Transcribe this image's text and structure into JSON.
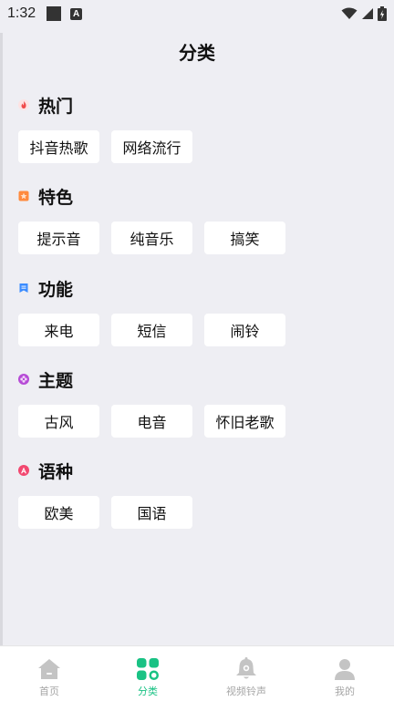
{
  "status_bar": {
    "time": "1:32",
    "badge_letter": "A"
  },
  "page": {
    "title": "分类"
  },
  "sections": [
    {
      "title": "热门",
      "icon": "fire-icon",
      "color": "#f04b4b",
      "chips": [
        "抖音热歌",
        "网络流行"
      ]
    },
    {
      "title": "特色",
      "icon": "star-square-icon",
      "color": "#ff8a3d",
      "chips": [
        "提示音",
        "纯音乐",
        "搞笑"
      ]
    },
    {
      "title": "功能",
      "icon": "bookmark-icon",
      "color": "#3b8cff",
      "chips": [
        "来电",
        "短信",
        "闹铃"
      ]
    },
    {
      "title": "主题",
      "icon": "flower-icon",
      "color": "#b64bd6",
      "chips": [
        "古风",
        "电音",
        "怀旧老歌"
      ]
    },
    {
      "title": "语种",
      "icon": "letter-a-icon",
      "color": "#f24870",
      "chips": [
        "欧美",
        "国语"
      ]
    }
  ],
  "bottom_nav": {
    "active_color": "#19c284",
    "inactive_color": "#c4c4c4",
    "items": [
      {
        "label": "首页",
        "icon": "home-icon"
      },
      {
        "label": "分类",
        "icon": "category-grid-icon"
      },
      {
        "label": "视频铃声",
        "icon": "bell-icon"
      },
      {
        "label": "我的",
        "icon": "person-icon"
      }
    ]
  }
}
